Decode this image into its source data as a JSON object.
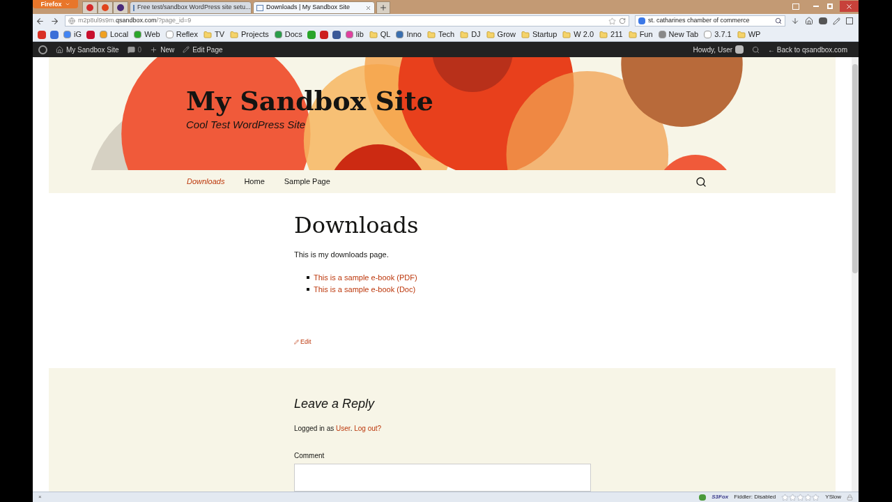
{
  "browser": {
    "menu_button": "Firefox",
    "pinned_tabs": [
      {
        "color": "#d42a2a"
      },
      {
        "color": "#e0441c"
      },
      {
        "color": "#4a2a7a"
      }
    ],
    "tabs": [
      {
        "title": "Free test/sandbox WordPress site setu...",
        "selected": false
      },
      {
        "title": "Downloads | My Sandbox Site",
        "selected": true
      }
    ],
    "url": {
      "host_prefix": "m2p8ul9s9m.",
      "host": "qsandbox.com",
      "path": "/?page_id=9"
    },
    "search": {
      "value": "st. catharines chamber of commerce"
    },
    "bookmarks": [
      {
        "kind": "icon",
        "color": "#d93025"
      },
      {
        "kind": "icon",
        "color": "#3b6fd8"
      },
      {
        "kind": "link",
        "label": "iG",
        "color": "#4285f4"
      },
      {
        "kind": "icon",
        "color": "#c8102e"
      },
      {
        "kind": "link",
        "label": "Local",
        "color": "#f0a020"
      },
      {
        "kind": "link",
        "label": "Web",
        "color": "#2aa52a"
      },
      {
        "kind": "link",
        "label": "Reflex",
        "color": "#ffffff"
      },
      {
        "kind": "folder",
        "label": "TV"
      },
      {
        "kind": "folder",
        "label": "Projects"
      },
      {
        "kind": "link",
        "label": "Docs",
        "color": "#2a9d4a"
      },
      {
        "kind": "icon",
        "color": "#2aa52a"
      },
      {
        "kind": "icon",
        "color": "#cc1f1f"
      },
      {
        "kind": "icon",
        "color": "#3b5998"
      },
      {
        "kind": "link",
        "label": "lib",
        "color": "#e040a0"
      },
      {
        "kind": "folder",
        "label": "QL"
      },
      {
        "kind": "link",
        "label": "Inno",
        "color": "#3a6fb0"
      },
      {
        "kind": "folder",
        "label": "Tech"
      },
      {
        "kind": "folder",
        "label": "DJ"
      },
      {
        "kind": "folder",
        "label": "Grow"
      },
      {
        "kind": "folder",
        "label": "Startup"
      },
      {
        "kind": "folder",
        "label": "W 2.0"
      },
      {
        "kind": "folder",
        "label": "211"
      },
      {
        "kind": "folder",
        "label": "Fun"
      },
      {
        "kind": "link",
        "label": "New Tab",
        "color": "#888888"
      },
      {
        "kind": "link",
        "label": "3.7.1",
        "color": "#ffffff"
      },
      {
        "kind": "folder",
        "label": "WP"
      }
    ]
  },
  "admin_bar": {
    "site": "My Sandbox Site",
    "comments": "0",
    "new": "New",
    "edit": "Edit Page",
    "howdy": "Howdy, User",
    "back": "← Back to qsandbox.com"
  },
  "site": {
    "title": "My Sandbox Site",
    "tagline": "Cool Test WordPress Site",
    "nav": [
      {
        "label": "Downloads",
        "selected": true
      },
      {
        "label": "Home",
        "selected": false
      },
      {
        "label": "Sample Page",
        "selected": false
      }
    ]
  },
  "page": {
    "heading": "Downloads",
    "intro": "This is my downloads page.",
    "links": [
      "This is a sample e-book (PDF)",
      "This is a sample e-book (Doc)"
    ],
    "edit": "Edit"
  },
  "reply": {
    "heading": "Leave a Reply",
    "logged_in": [
      {
        "kind": "text",
        "text": "Logged in as "
      },
      {
        "kind": "link",
        "text": "User"
      },
      {
        "kind": "text",
        "text": ". "
      },
      {
        "kind": "link",
        "text": "Log out?"
      }
    ],
    "comment_label": "Comment"
  },
  "status_bar": {
    "close": "×",
    "s3fox": "S3Fox",
    "fiddler": "Fiddler: Disabled",
    "stars": 0,
    "yslow": "YSlow"
  }
}
